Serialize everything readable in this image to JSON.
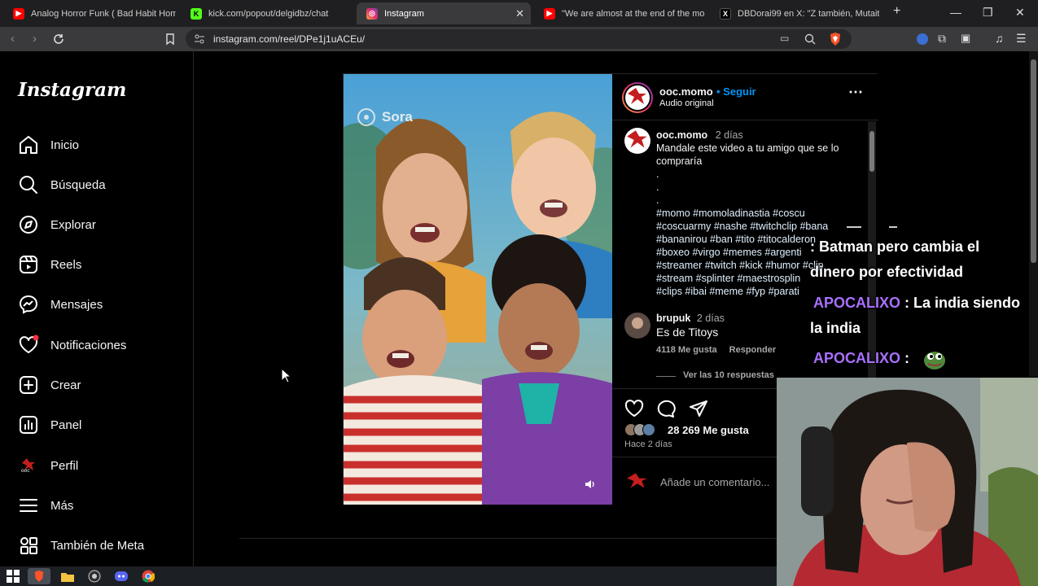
{
  "browser": {
    "tabs": [
      {
        "title": "Analog Horror Funk ( Bad Habit Hom",
        "icon": "youtube-icon",
        "active": false
      },
      {
        "title": "kick.com/popout/delgidbz/chat",
        "icon": "kick-icon",
        "active": false
      },
      {
        "title": "Instagram",
        "icon": "instagram-icon",
        "active": true
      },
      {
        "title": "\"We are almost at the end of the mo",
        "icon": "youtube-icon",
        "active": false
      },
      {
        "title": "DBDorai99 en X: \"Z también, Mutait",
        "icon": "x-icon",
        "active": false
      }
    ],
    "new_tab": "+",
    "url": "instagram.com/reel/DPe1j1uACEu/",
    "colors": {
      "tabbar": "#1f1f21",
      "toolbar": "#3a3a3c",
      "brave": "#fb542b"
    }
  },
  "sidebar": {
    "logo": "Instagram",
    "items": [
      {
        "label": "Inicio",
        "icon": "home-icon"
      },
      {
        "label": "Búsqueda",
        "icon": "search-icon"
      },
      {
        "label": "Explorar",
        "icon": "compass-icon"
      },
      {
        "label": "Reels",
        "icon": "reels-icon"
      },
      {
        "label": "Mensajes",
        "icon": "messenger-icon"
      },
      {
        "label": "Notificaciones",
        "icon": "heart-icon"
      },
      {
        "label": "Crear",
        "icon": "plus-square-icon"
      },
      {
        "label": "Panel",
        "icon": "chart-icon"
      },
      {
        "label": "Perfil",
        "icon": "avatar"
      },
      {
        "label": "Más",
        "icon": "menu-icon"
      },
      {
        "label": "También de Meta",
        "icon": "meta-icon"
      }
    ]
  },
  "post": {
    "video_watermark": "Sora",
    "author": "ooc.momo",
    "follow": "• Seguir",
    "audio": "Audio original",
    "caption": {
      "user": "ooc.momo",
      "time": "2 días",
      "text": "Mandale este video a tu amigo que se lo compraría",
      "dots": [
        ".",
        ".",
        "."
      ],
      "hashtags": [
        "#momo #momoladinastia #coscu",
        "#coscuarmy #nashe #twitchclip #bana",
        "#bananirou #ban #tito #titocalderon",
        "#boxeo #virgo #memes #argenti",
        "#streamer #twitch #kick #humor #clip",
        "#stream #splinter #maestrosplin",
        "#clips #ibai #meme #fyp #parati"
      ]
    },
    "comment": {
      "user": "brupuk",
      "time": "2 días",
      "text": "Es de Titoys",
      "likes": "4118 Me gusta",
      "reply": "Responder",
      "view_replies": "Ver las 10 respuestas"
    },
    "likes": "28 269 Me gusta",
    "posted": "Hace 2 días",
    "add_comment": "Añade un comentario..."
  },
  "stream_chat": [
    {
      "name": "",
      "text": ": Batman pero cambia el"
    },
    {
      "name": "",
      "text": "dinero por efectividad"
    },
    {
      "name": "APOCALIXO",
      "text": " : La india siendo"
    },
    {
      "name": "",
      "text": "la india"
    },
    {
      "name": "APOCALIXO",
      "text": " :"
    }
  ]
}
